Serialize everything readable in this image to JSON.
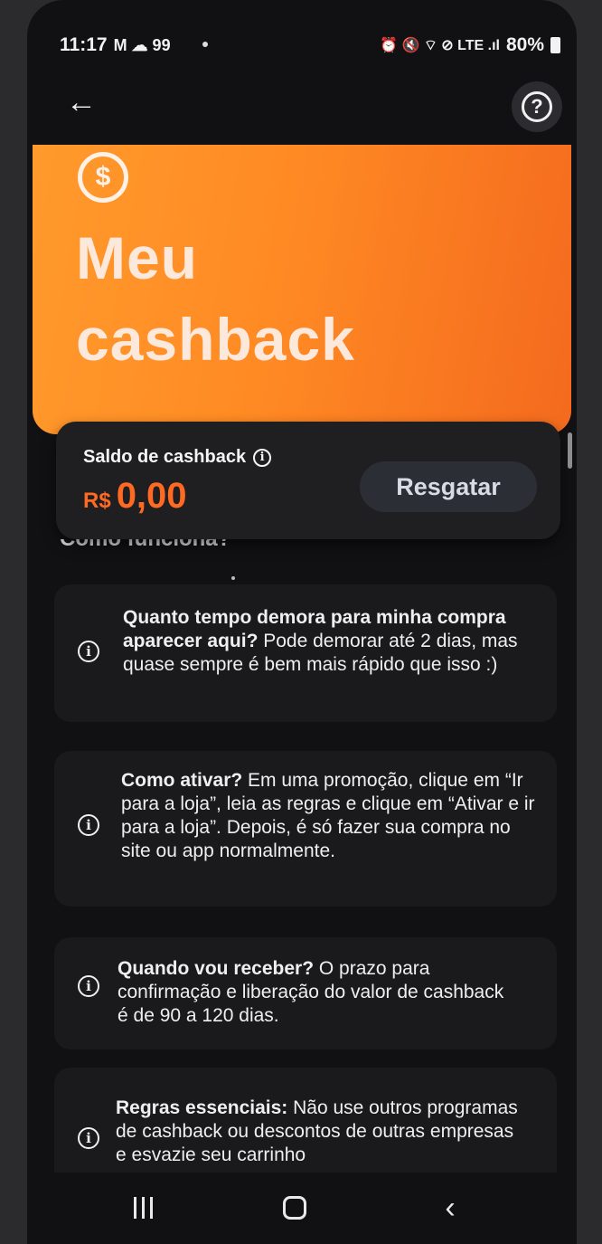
{
  "status_bar": {
    "time": "11:17",
    "left_icons": "M ☁ 99",
    "right_icons": "⏰ 🔇 ⌔ ⊘ LTE .ıl",
    "battery": "80%"
  },
  "header": {
    "back_icon": "←",
    "help_icon": "?"
  },
  "hero": {
    "icon": "$",
    "title": "Meu cashback",
    "background": "#ff8a24"
  },
  "balance": {
    "label": "Saldo de cashback",
    "info_icon": "i",
    "currency": "R$",
    "amount": "0,00",
    "redeem_label": "Resgatar",
    "accent": "#ff6a22"
  },
  "section_heading": "Como funciona?",
  "faq": [
    {
      "question": "Quanto tempo demora para minha compra aparecer aqui?",
      "answer": " Pode demorar até 2 dias, mas quase sempre é bem mais rápido que isso :)"
    },
    {
      "question": "Como ativar?",
      "answer": " Em uma promoção, clique em “Ir para a loja”, leia as regras e clique em  “Ativar e ir para a loja”. Depois, é só fazer sua compra no site ou app normalmente."
    },
    {
      "question": "Quando vou receber?",
      "answer": " O prazo para confirmação e liberação do valor de cashback é de 90 a 120 dias."
    },
    {
      "question": "Regras essenciais:",
      "answer": " Não use outros programas de cashback ou descontos de outras empresas e esvazie seu carrinho"
    }
  ],
  "nav": {
    "recents": "recents",
    "home": "home",
    "back": "‹"
  }
}
